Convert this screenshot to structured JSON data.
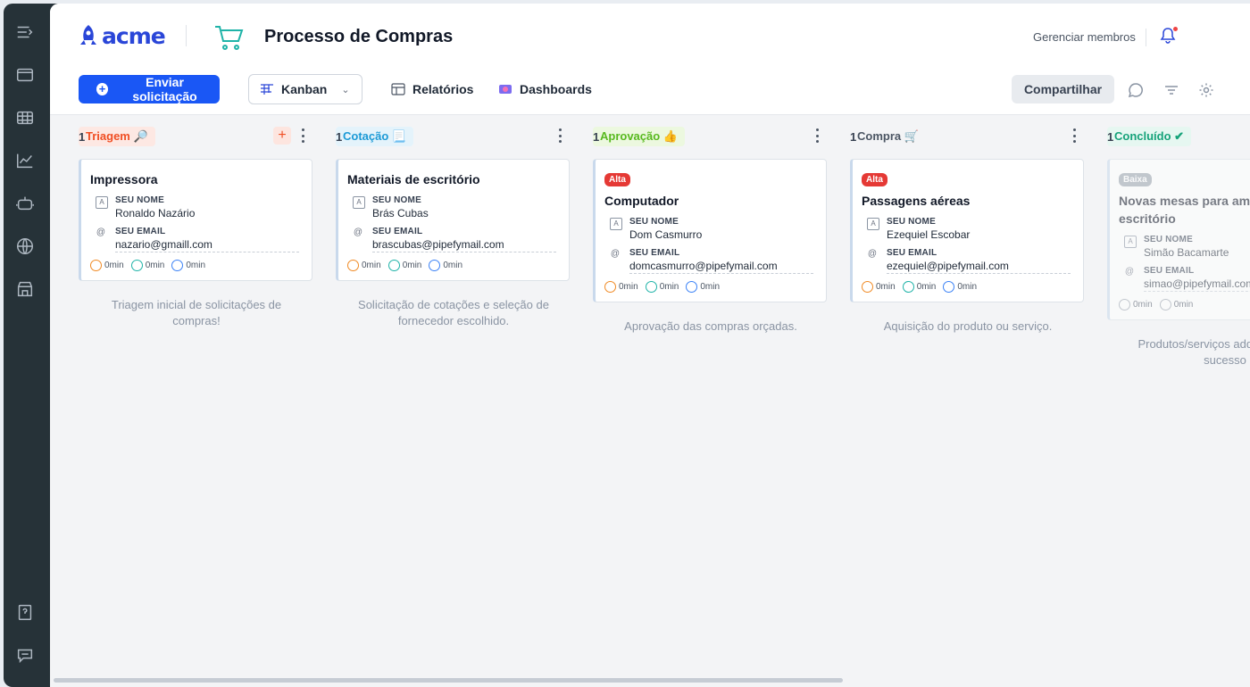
{
  "app": {
    "logo_text": "acme",
    "pipe_title": "Processo de Compras",
    "manage_members": "Gerenciar membros"
  },
  "toolbar": {
    "send_request": "Enviar solicitação",
    "view_mode": "Kanban",
    "reports": "Relatórios",
    "dashboards": "Dashboards",
    "share": "Compartilhar"
  },
  "sidebar": {
    "icons": [
      "menu-expand-icon",
      "browser-window-icon",
      "table-icon",
      "chart-icon",
      "robot-icon",
      "globe-icon",
      "store-icon",
      "help-doc-icon",
      "chat-icon"
    ]
  },
  "colors": {
    "primary": "#1a57f5",
    "sidebar": "#263238",
    "alta": "#e53935",
    "baixa": "#9aa3ad"
  },
  "columns": [
    {
      "phase": "Triagem 🔎",
      "count": "1",
      "pill_bg": "#fde8e3",
      "pill_color": "#f04e23",
      "description": "Triagem inicial de solicitações de compras!",
      "cards": [
        {
          "badge": "",
          "title": "Impressora",
          "name_label": "SEU NOME",
          "name": "Ronaldo Nazário",
          "email_label": "SEU EMAIL",
          "email": "nazario@gmaill.com",
          "t1": "0min",
          "t2": "0min",
          "t3": "0min"
        }
      ]
    },
    {
      "phase": "Cotação 📃",
      "count": "1",
      "pill_bg": "#e4f3fb",
      "pill_color": "#1c9ad6",
      "description": "Solicitação de cotações e seleção de fornecedor escolhido.",
      "cards": [
        {
          "badge": "",
          "title": "Materiais de escritório",
          "name_label": "SEU NOME",
          "name": "Brás Cubas",
          "email_label": "SEU EMAIL",
          "email": "brascubas@pipefymail.com",
          "t1": "0min",
          "t2": "0min",
          "t3": "0min"
        }
      ]
    },
    {
      "phase": "Aprovação 👍",
      "count": "1",
      "pill_bg": "#ecf8df",
      "pill_color": "#58b91f",
      "description": "Aprovação das compras orçadas.",
      "cards": [
        {
          "badge": "Alta",
          "title": "Computador",
          "name_label": "SEU NOME",
          "name": "Dom Casmurro",
          "email_label": "SEU EMAIL",
          "email": "domcasmurro@pipefymail.com",
          "t1": "0min",
          "t2": "0min",
          "t3": "0min"
        }
      ]
    },
    {
      "phase": "Compra 🛒",
      "count": "1",
      "pill_bg": "#f3f4f6",
      "pill_color": "#4b5563",
      "description": "Aquisição do produto ou serviço.",
      "cards": [
        {
          "badge": "Alta",
          "title": "Passagens aéreas",
          "name_label": "SEU NOME",
          "name": "Ezequiel Escobar",
          "email_label": "SEU EMAIL",
          "email": "ezequiel@pipefymail.com",
          "t1": "0min",
          "t2": "0min",
          "t3": "0min"
        }
      ]
    },
    {
      "phase": "Concluído ✔",
      "count": "1",
      "pill_bg": "#e6f7f1",
      "pill_color": "#16a37a",
      "description": "Produtos/serviços adquiridos com sucesso",
      "cards": [
        {
          "badge": "Baixa",
          "title": "Novas mesas para ambiente do escritório",
          "name_label": "SEU NOME",
          "name": "Simão Bacamarte",
          "email_label": "SEU EMAIL",
          "email": "simao@pipefymail.com",
          "t1": "0min",
          "t2": "0min"
        }
      ]
    }
  ]
}
